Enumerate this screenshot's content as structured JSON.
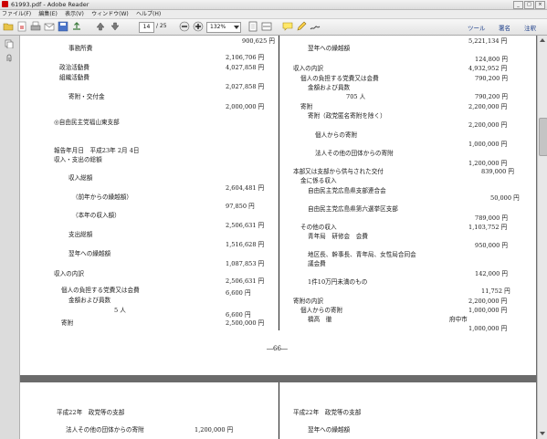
{
  "window": {
    "title": "61993.pdf - Adobe Reader"
  },
  "menu": [
    "ファイル(F)",
    "編集(E)",
    "表示(V)",
    "ウィンドウ(W)",
    "ヘルプ(H)"
  ],
  "toolbar": {
    "page_current": "14",
    "page_total": "/ 25",
    "zoom": "132%",
    "right_links": [
      "ツール",
      "署名",
      "注釈"
    ]
  },
  "icons": {
    "toolbar": [
      "open-icon",
      "create-pdf-icon",
      "print-icon",
      "email-icon",
      "save-icon",
      "upload-icon",
      "prev-page-icon",
      "next-page-icon",
      "zoom-out-icon",
      "zoom-in-icon",
      "fit-page-icon",
      "fit-width-icon",
      "comment-icon",
      "highlight-icon",
      "sign-icon"
    ],
    "sidebar": [
      "page-thumbnails-icon",
      "attachments-icon"
    ]
  },
  "page1": {
    "left": [
      {
        "text": "900,625 円"
      },
      {
        "text": "事務所費"
      },
      {
        "text": "2,106,706 円"
      },
      {
        "text": "政治活動費"
      },
      {
        "text": "4,027,858 円"
      },
      {
        "text": "組織活動費"
      },
      {
        "text": "2,027,858 円"
      },
      {
        "text": "寄附・交付金"
      },
      {
        "text": "2,000,000 円"
      },
      {
        "text": "◎自由民主党福山東支部"
      },
      {
        "text": "報告年月日　平成23年 2月 4日"
      },
      {
        "text": "収入・支出の総額"
      },
      {
        "text": "収入総額"
      },
      {
        "text": "2,604,481 円"
      },
      {
        "text": "（前年からの繰越額）"
      },
      {
        "text": "97,850 円"
      },
      {
        "text": "（本年の収入額）"
      },
      {
        "text": "2,506,631 円"
      },
      {
        "text": "支出総額"
      },
      {
        "text": "1,516,628 円"
      },
      {
        "text": "翌年への繰越額"
      },
      {
        "text": "1,087,853 円"
      },
      {
        "text": "収入の内訳"
      },
      {
        "text": "2,506,631 円"
      },
      {
        "text": "個人の負担する党費又は会費"
      },
      {
        "text": "6,600 円"
      },
      {
        "text": "金額および員数"
      },
      {
        "text": "5 人"
      },
      {
        "text": "6,600 円"
      },
      {
        "text": "寄附"
      },
      {
        "text": "2,500,000 円"
      }
    ],
    "right": [
      {
        "text": "5,221,134 円"
      },
      {
        "text": "翌年への繰越額"
      },
      {
        "text": "124,800 円"
      },
      {
        "text": "収入の内訳"
      },
      {
        "text": "4,932,952 円"
      },
      {
        "text": "個人の負担する党費又は会費"
      },
      {
        "text": "790,200 円"
      },
      {
        "text": "金額および員数"
      },
      {
        "text": "705 人"
      },
      {
        "text": "790,200 円"
      },
      {
        "text": "寄附"
      },
      {
        "text": "2,200,000 円"
      },
      {
        "text": "寄附（政党匿名寄附を除く）"
      },
      {
        "text": "2,200,000 円"
      },
      {
        "text": "個人からの寄附"
      },
      {
        "text": "1,000,000 円"
      },
      {
        "text": "法人その他の団体からの寄附"
      },
      {
        "text": "1,200,000 円"
      },
      {
        "text": "本部又は支部から供与された交付"
      },
      {
        "text": "839,000 円"
      },
      {
        "text": "金に係る収入"
      },
      {
        "text": "自由民主党広島県支部連合会"
      },
      {
        "text": "50,000 円"
      },
      {
        "text": "自由民主党広島県第六選挙区支部"
      },
      {
        "text": "789,000 円"
      },
      {
        "text": "その他の収入"
      },
      {
        "text": "1,103,752 円"
      },
      {
        "text": "青年局　研修会　会費"
      },
      {
        "text": "950,000 円"
      },
      {
        "text": "地区長、幹事長、青年局、女性局合同会"
      },
      {
        "text": "議会費"
      },
      {
        "text": "142,000 円"
      },
      {
        "text": "1件10万円未満のもの"
      },
      {
        "text": "11,752 円"
      },
      {
        "text": "寄附の内訳"
      },
      {
        "text": "2,200,000 円"
      },
      {
        "text": "個人からの寄附"
      },
      {
        "text": "1,000,000 円"
      },
      {
        "text": "府中市"
      },
      {
        "text": "橋高　徹"
      },
      {
        "text": "1,000,000 円"
      }
    ],
    "page_number": "―66―"
  },
  "page2": {
    "left": [
      {
        "text": "平成22年　政党等の支部"
      },
      {
        "text": "法人その他の団体からの寄附"
      },
      {
        "text": "1,200,000 円"
      }
    ],
    "right": [
      {
        "text": "平成22年　政党等の支部"
      },
      {
        "text": "翌年への繰越額"
      }
    ]
  }
}
